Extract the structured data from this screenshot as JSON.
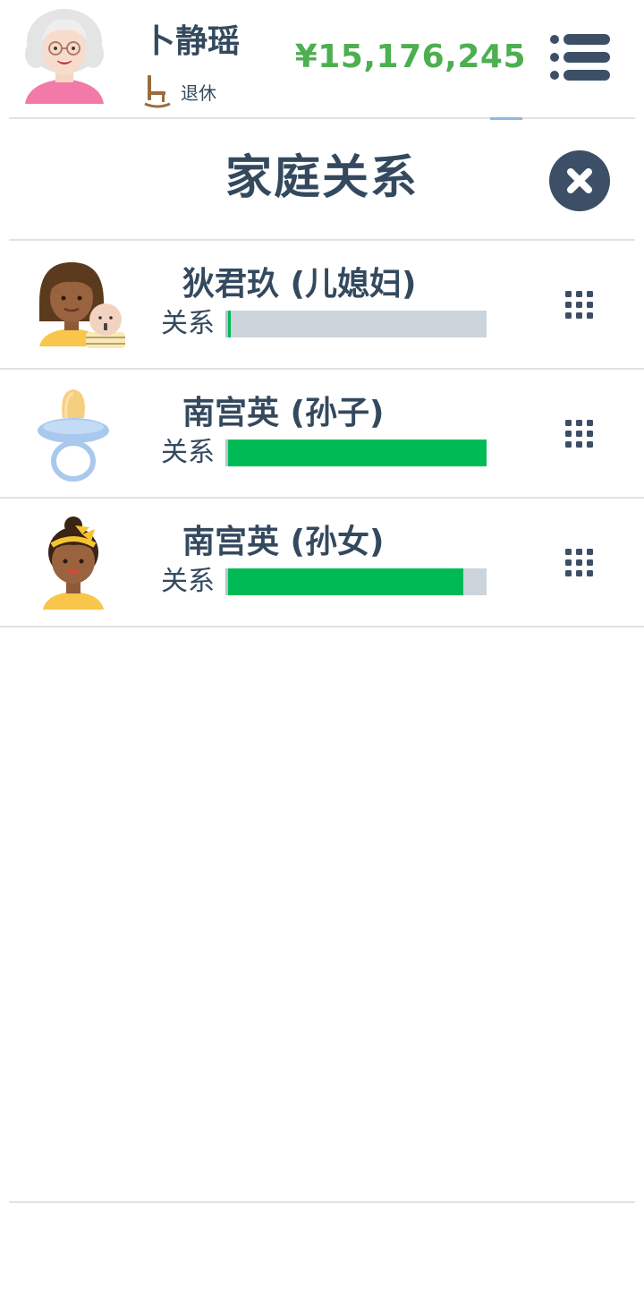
{
  "header": {
    "player_name": "卜静瑶",
    "status_text": "退休",
    "status_icon": "rocking-chair-icon",
    "money": "¥15,176,245",
    "money_color": "#4caf50",
    "menu_icon": "list-menu-icon"
  },
  "dialog": {
    "title": "家庭关系",
    "close_icon": "close-icon"
  },
  "family": [
    {
      "name": "狄君玖 (儿媳妇)",
      "relationship_label": "关系",
      "relationship_level": 0.01,
      "avatar_icon": "woman-with-baby-avatar",
      "action_icon": "grid-dots-icon"
    },
    {
      "name": "南宫英 (孙子)",
      "relationship_label": "关系",
      "relationship_level": 1.0,
      "avatar_icon": "pacifier-icon",
      "action_icon": "grid-dots-icon"
    },
    {
      "name": "南宫英 (孙女)",
      "relationship_label": "关系",
      "relationship_level": 0.91,
      "avatar_icon": "baby-girl-avatar",
      "action_icon": "grid-dots-icon"
    }
  ],
  "colors": {
    "primary_text": "#34495e",
    "bar_fill": "#00bb55",
    "bar_track": "#ccd4db",
    "close_button": "#3d4f66"
  }
}
